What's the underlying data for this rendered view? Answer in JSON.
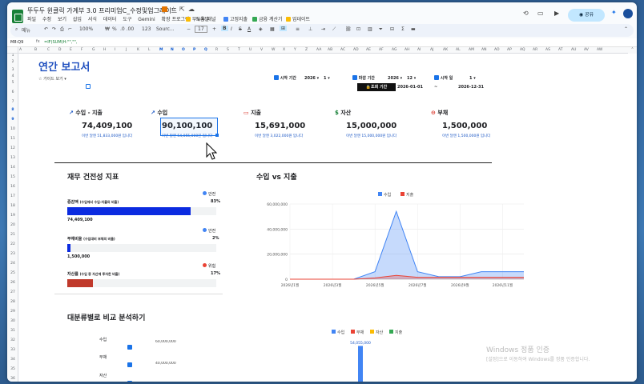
{
  "app": {
    "doc_title": "뚜두두 윈클릭 가계부 3.0 프리미엄C_수정및업그레이드",
    "menus": [
      "파일",
      "수정",
      "보기",
      "삽입",
      "서식",
      "데이터",
      "도구",
      "Gemini",
      "확장 프로그램",
      "도움말"
    ],
    "bookmarks": [
      "뚜두두 패널",
      "고정지출",
      "금융 계산기",
      "업데이트"
    ],
    "share_label": "공유"
  },
  "toolbar": {
    "menu_label": "메뉴",
    "zoom": "100%",
    "currency": "₩",
    "percent": "%",
    "decimals": ".0  .00",
    "number_fmt": "123",
    "font": "Sourc...",
    "font_size": "17",
    "bold": "B",
    "italic": "I",
    "strike": "S",
    "text_color": "A"
  },
  "formula": {
    "cell_ref": "M8:Q9",
    "formula_text": "=IF(SUM(H:\"\",\"\","
  },
  "grid": {
    "columns": [
      "A",
      "B",
      "C",
      "D",
      "E",
      "F",
      "G",
      "H",
      "I",
      "J",
      "K",
      "L",
      "M",
      "N",
      "O",
      "P",
      "Q",
      "R",
      "S",
      "T",
      "U",
      "V",
      "W",
      "X",
      "Y",
      "Z",
      "AA",
      "AB",
      "AC",
      "AD",
      "AE",
      "AF",
      "AG",
      "AH",
      "AI",
      "AJ",
      "AK",
      "AL",
      "AM",
      "AN",
      "AO",
      "AP",
      "AQ",
      "AR",
      "AS",
      "AT",
      "AU",
      "AV",
      "AW"
    ],
    "rows": [
      "1",
      "2",
      "3",
      "4",
      "5",
      "6",
      "7",
      "8",
      "9",
      "10",
      "11",
      "12",
      "13",
      "14",
      "15",
      "16",
      "17",
      "18",
      "19",
      "20",
      "21",
      "22",
      "23",
      "24",
      "25",
      "26",
      "27",
      "28",
      "29",
      "30",
      "31",
      "32",
      "33",
      "34",
      "35",
      "36",
      "37",
      "38",
      "39"
    ]
  },
  "report": {
    "title": "연간 보고서",
    "guide_label": "가이드 보기",
    "start_period_label": "시작 기간",
    "start_year": "2026",
    "start_month": "1",
    "end_period_label": "마감 기간",
    "end_year": "2026",
    "end_month": "12",
    "start_day_label": "시작 일",
    "start_day": "1",
    "query_button": "조회 기간",
    "date_from": "2026-01-01",
    "date_to": "2026-12-31",
    "date_sep": "~"
  },
  "cards": [
    {
      "title": "수입 - 지출",
      "value": "74,409,100",
      "sub": "이번 달엔 51,833,000원 입니다",
      "icon": "trend-up-icon",
      "color": "#1a56c4"
    },
    {
      "title": "수입",
      "value": "90,100,100",
      "sub": "이번 달엔 54,055,000원 입니다",
      "icon": "trend-up-icon",
      "color": "#1a56c4"
    },
    {
      "title": "지출",
      "value": "15,691,000",
      "sub": "이번 달엔 3,022,000원 입니다",
      "icon": "wallet-icon",
      "color": "#d93025"
    },
    {
      "title": "자산",
      "value": "15,000,000",
      "sub": "이번 달엔 15,000,000원 입니다",
      "icon": "money-icon",
      "color": "#188038"
    },
    {
      "title": "부채",
      "value": "1,500,000",
      "sub": "이번 달엔 1,500,000원 입니다",
      "icon": "debt-icon",
      "color": "#d93025"
    }
  ],
  "health": {
    "title": "재무 건전성 지표",
    "subtitle": "",
    "items": [
      {
        "label": "증감액",
        "note": "(수입에서 수입-지출의 비율)",
        "status": "안전",
        "status_color": "#4285f4",
        "pct_text": "83%",
        "fraction": 0.83,
        "bar_color": "#0b2be0",
        "value": "74,409,100"
      },
      {
        "label": "부채비율",
        "note": "(수입대비 부채의 비율)",
        "status": "안전",
        "status_color": "#4285f4",
        "pct_text": "2%",
        "fraction": 0.02,
        "bar_color": "#0b2be0",
        "value": "1,500,000"
      },
      {
        "label": "자산률",
        "note": "(수입 중 자산에 투자한 비율)",
        "status": "위험",
        "status_color": "#ea4335",
        "pct_text": "17%",
        "fraction": 0.17,
        "bar_color": "#c0392b",
        "value": ""
      }
    ]
  },
  "line_chart_panel": {
    "title": "수입 vs 지출",
    "subtitle": ""
  },
  "compare": {
    "title": "대분류별로 비교 분석하기",
    "subtitle": "",
    "checks": [
      {
        "label": "수입",
        "checked": true
      },
      {
        "label": "부채",
        "checked": true
      },
      {
        "label": "자산",
        "checked": true
      }
    ]
  },
  "watermark": {
    "line1": "Windows 정품 인증",
    "line2": "[설정]으로 이동하여 Windows를 정품 인증합니다."
  },
  "chart_data": [
    {
      "type": "area",
      "title": "수입 vs 지출",
      "legend": [
        "수입",
        "지출"
      ],
      "legend_position": "top",
      "categories": [
        "2026년1월",
        "2026년2월",
        "2026년3월",
        "2026년4월",
        "2026년5월",
        "2026년6월",
        "2026년7월",
        "2026년8월",
        "2026년9월",
        "2026년10월",
        "2026년11월",
        "2026년12월"
      ],
      "x_tick_labels": [
        "2026년1월",
        "2026년3월",
        "2026년5월",
        "2026년7월",
        "2026년9월",
        "2026년11월"
      ],
      "y_tick_labels": [
        "0",
        "20,000,000",
        "40,000,000",
        "60,000,000"
      ],
      "ylim": [
        0,
        60000000
      ],
      "series": [
        {
          "name": "수입",
          "color": "#4285f4",
          "values": [
            0,
            0,
            0,
            0,
            6000000,
            54055000,
            6000000,
            2000000,
            2000000,
            6000000,
            6000000,
            6000000
          ]
        },
        {
          "name": "지출",
          "color": "#ea4335",
          "values": [
            0,
            0,
            0,
            0,
            1000000,
            3022000,
            1500000,
            1500000,
            1500000,
            1500000,
            1500000,
            1500000
          ]
        }
      ],
      "grid": true
    },
    {
      "type": "bar",
      "legend": [
        "수입",
        "부채",
        "자산",
        "지출"
      ],
      "legend_colors": [
        "#4285f4",
        "#ea4335",
        "#fbbc04",
        "#34a853"
      ],
      "legend_position": "top",
      "y_tick_labels": [
        "60,000,000",
        "40,000,000"
      ],
      "data_labels": [
        "54,055,000"
      ],
      "series": [
        {
          "name": "수입",
          "values": [
            54055000
          ]
        }
      ],
      "grid": false
    }
  ]
}
